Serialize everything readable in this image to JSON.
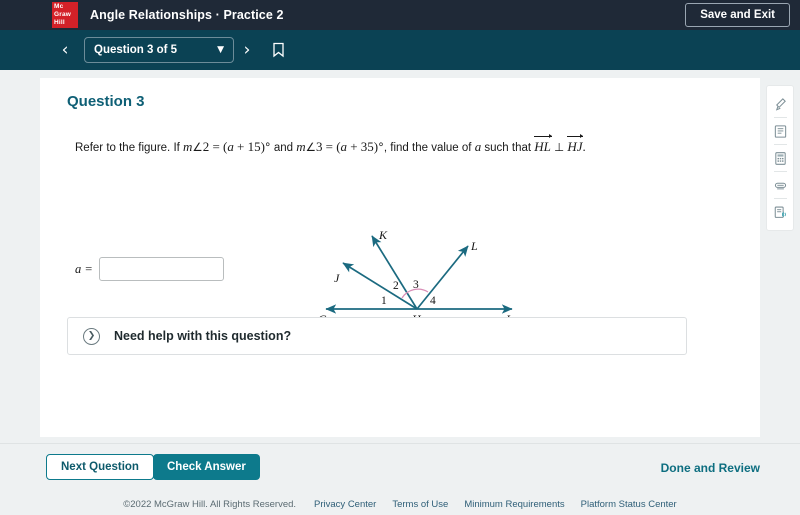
{
  "topbar": {
    "logo_lines": [
      "Mc",
      "Graw",
      "Hill"
    ],
    "title": "Angle Relationships · Practice 2",
    "save_exit_label": "Save and Exit"
  },
  "navbar": {
    "prev_icon": "chevron-left-icon",
    "next_icon": "chevron-right-icon",
    "question_selector": "Question 3 of 5",
    "caret_icon": "chevron-down-icon",
    "bookmark_icon": "bookmark-icon"
  },
  "question": {
    "heading": "Question 3",
    "prompt_part1": "Refer to the figure. If ",
    "m_angle_2": {
      "m": "m",
      "angle": "∠",
      "num": "2",
      "eq": "=",
      "expr_open": "(",
      "var": "a",
      "plus": "+",
      "value": "15",
      "expr_close": ")",
      "deg": "°"
    },
    "prompt_and": " and ",
    "m_angle_3": {
      "m": "m",
      "angle": "∠",
      "num": "3",
      "eq": "=",
      "expr_open": "(",
      "var": "a",
      "plus": "+",
      "value": "35",
      "expr_close": ")",
      "deg": "°"
    },
    "prompt_part2": ", find the value of ",
    "variable": "a",
    "prompt_part3": " such that ",
    "ray1": "HL",
    "perp": "⊥",
    "ray2": "HJ",
    "period": "."
  },
  "figure": {
    "points": [
      "G",
      "H",
      "I",
      "J",
      "K",
      "L"
    ],
    "angle_numbers": [
      "1",
      "2",
      "3",
      "4"
    ],
    "marked_angle": "3",
    "line_color": "#1b6a80",
    "arc_color": "#d98fb8"
  },
  "answer": {
    "label": "a =",
    "value": "",
    "placeholder": ""
  },
  "help": {
    "icon": "chevron-right-circle-icon",
    "text": "Need help with this question?"
  },
  "tools": [
    {
      "name": "highlighter-icon",
      "label": "Highlighter"
    },
    {
      "name": "notes-icon",
      "label": "Notes"
    },
    {
      "name": "calculator-icon",
      "label": "Calculator"
    },
    {
      "name": "eraser-icon",
      "label": "Eraser"
    },
    {
      "name": "read-aloud-icon",
      "label": "Read Aloud"
    }
  ],
  "footer": {
    "next_label": "Next Question",
    "check_label": "Check Answer",
    "done_label": "Done and Review"
  },
  "copyright": {
    "text": "©2022 McGraw Hill. All Rights Reserved.",
    "links": [
      "Privacy Center",
      "Terms of Use",
      "Minimum Requirements",
      "Platform Status Center"
    ]
  },
  "colors": {
    "topbar_bg": "#1f2937",
    "navbar_bg": "#0b4254",
    "accent_teal": "#0d7a8c",
    "heading_teal": "#0e5f75",
    "logo_red": "#d32128"
  }
}
